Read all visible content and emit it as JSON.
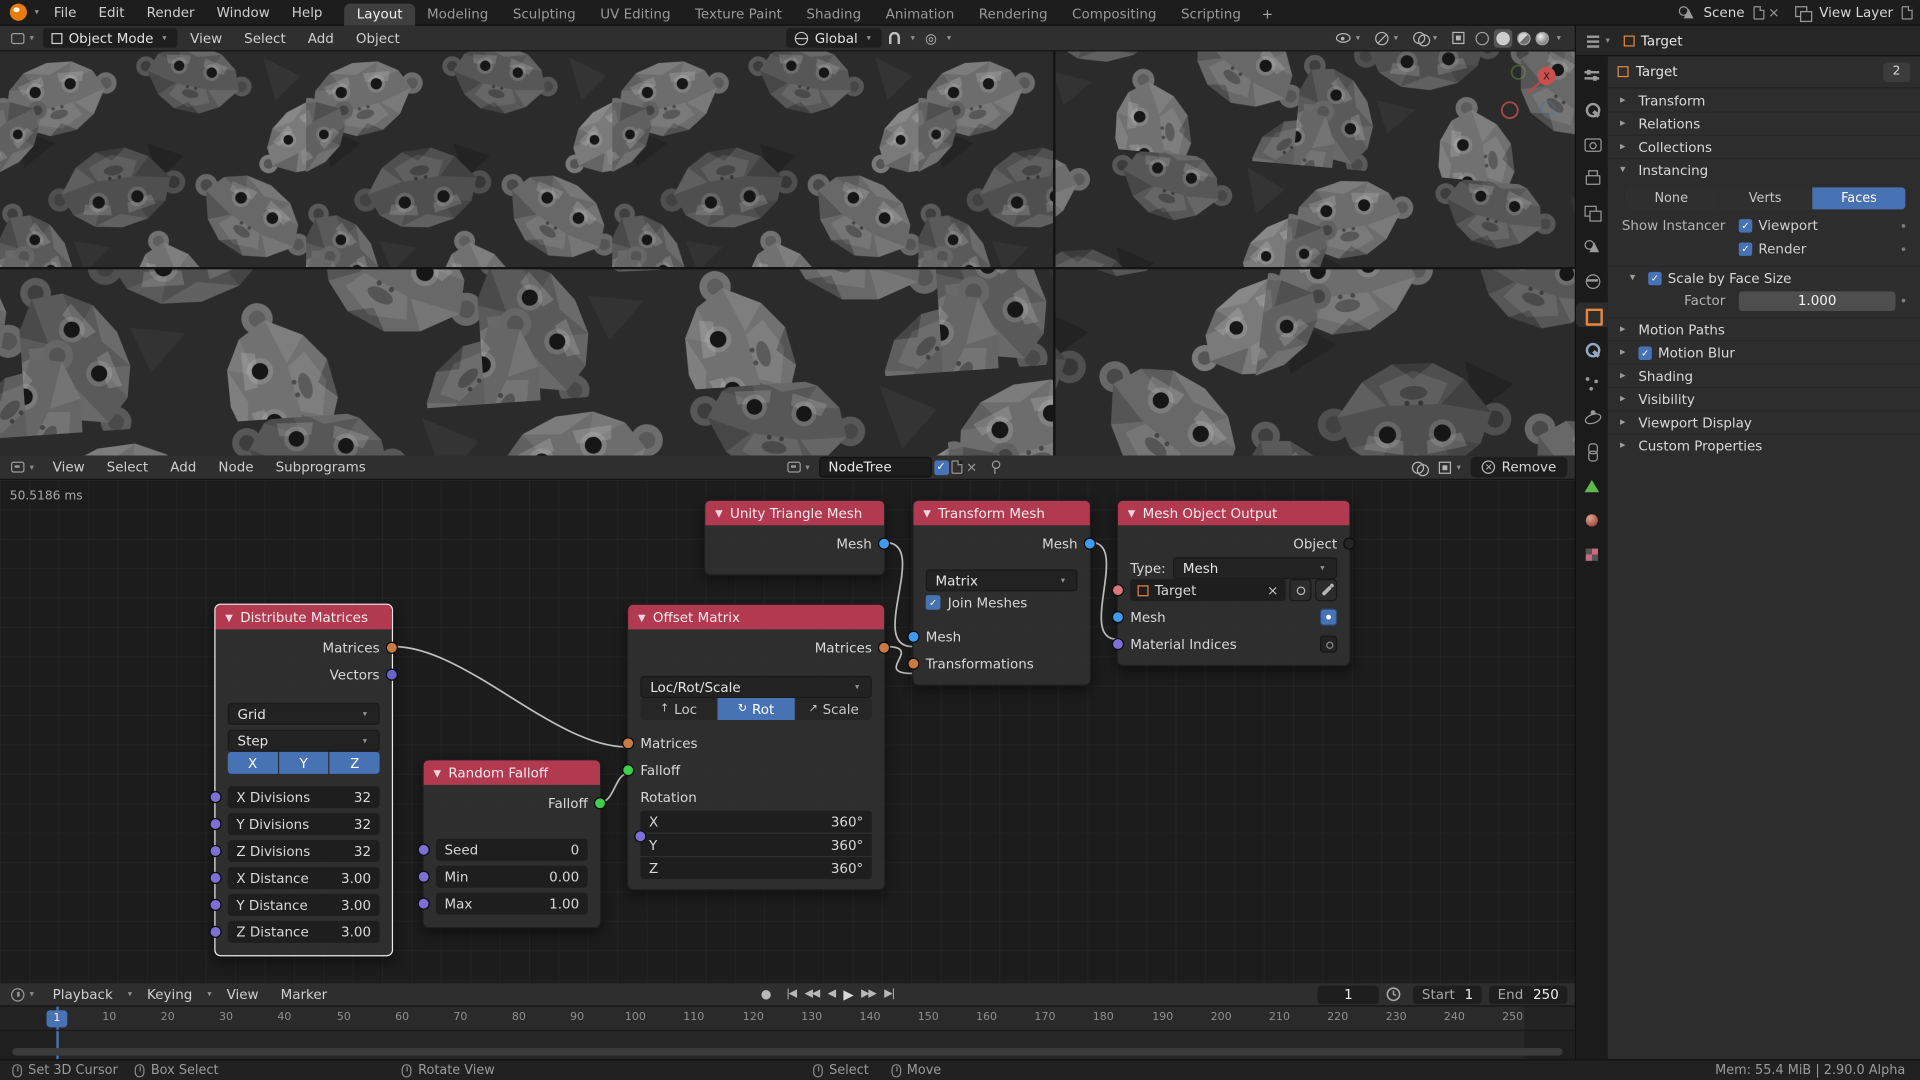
{
  "icons": {
    "record": "●",
    "jump_start": "|◀",
    "prev_key": "◀◀",
    "play_reverse": "◀",
    "play": "▶",
    "next_key": "▶▶",
    "jump_end": "▶|"
  },
  "colors": {
    "accent": "#4772b3",
    "node_header": "#b23a50",
    "blender_orange": "#e87d0d",
    "socket_matrix": "#c87a45",
    "socket_vector": "#6a63c9",
    "socket_number": "#7d6fd6",
    "socket_mesh": "#3f9bf0",
    "socket_falloff": "#3ecf4a",
    "socket_object": "#242424"
  },
  "topbar": {
    "menus": [
      "File",
      "Edit",
      "Render",
      "Window",
      "Help"
    ],
    "workspaces": [
      "Layout",
      "Modeling",
      "Sculpting",
      "UV Editing",
      "Texture Paint",
      "Shading",
      "Animation",
      "Rendering",
      "Compositing",
      "Scripting"
    ],
    "new_workspace": "+",
    "scene": "Scene",
    "view_layer": "View Layer"
  },
  "viewport_header": {
    "mode": "Object Mode",
    "menus": [
      "View",
      "Select",
      "Add",
      "Object"
    ],
    "orientation": "Global"
  },
  "viewport": {
    "gizmo_x": "X"
  },
  "node_editor": {
    "menus": [
      "View",
      "Select",
      "Add",
      "Node",
      "Subprograms"
    ],
    "tree_name": "NodeTree",
    "remove": "Remove",
    "stats": "50.5186 ms"
  },
  "nodes": {
    "distribute": {
      "title": "Distribute Matrices",
      "out1": "Matrices",
      "out2": "Vectors",
      "dd1": "Grid",
      "dd2": "Step",
      "ax": [
        "X",
        "Y",
        "Z"
      ],
      "rows": [
        {
          "l": "X Divisions",
          "v": "32"
        },
        {
          "l": "Y Divisions",
          "v": "32"
        },
        {
          "l": "Z Divisions",
          "v": "32"
        },
        {
          "l": "X Distance",
          "v": "3.00"
        },
        {
          "l": "Y Distance",
          "v": "3.00"
        },
        {
          "l": "Z Distance",
          "v": "3.00"
        }
      ]
    },
    "falloff": {
      "title": "Random Falloff",
      "out": "Falloff",
      "rows": [
        {
          "l": "Seed",
          "v": "0"
        },
        {
          "l": "Min",
          "v": "0.00"
        },
        {
          "l": "Max",
          "v": "1.00"
        }
      ]
    },
    "offset": {
      "title": "Offset Matrix",
      "out": "Matrices",
      "dd": "Loc/Rot/Scale",
      "modes": [
        "Loc",
        "Rot",
        "Scale"
      ],
      "in1": "Matrices",
      "in2": "Falloff",
      "in3": "Rotation",
      "rows": [
        {
          "l": "X",
          "v": "360°"
        },
        {
          "l": "Y",
          "v": "360°"
        },
        {
          "l": "Z",
          "v": "360°"
        }
      ]
    },
    "unity": {
      "title": "Unity Triangle Mesh",
      "out": "Mesh"
    },
    "transform": {
      "title": "Transform Mesh",
      "out": "Mesh",
      "dd": "Matrix",
      "check": "Join Meshes",
      "in1": "Mesh",
      "in2": "Transformations"
    },
    "output": {
      "title": "Mesh Object Output",
      "out": "Object",
      "type_label": "Type:",
      "type_value": "Mesh",
      "object_name": "Target",
      "in1": "Mesh",
      "in2": "Material Indices"
    }
  },
  "timeline": {
    "menus": [
      "Playback",
      "Keying",
      "View",
      "Marker"
    ],
    "frame": "1",
    "start_label": "Start",
    "start": "1",
    "end_label": "End",
    "end": "250",
    "playhead": "1",
    "ticks": [
      "1",
      "10",
      "20",
      "30",
      "40",
      "50",
      "60",
      "70",
      "80",
      "90",
      "100",
      "110",
      "120",
      "130",
      "140",
      "150",
      "160",
      "170",
      "180",
      "190",
      "200",
      "210",
      "220",
      "230",
      "240",
      "250"
    ]
  },
  "statusbar": {
    "items": [
      "Set 3D Cursor",
      "Box Select",
      "Rotate View",
      "Select",
      "Move"
    ],
    "info": "Mem: 55.4 MiB | 2.90.0 Alpha"
  },
  "outliner": {
    "item": "Target"
  },
  "properties": {
    "breadcrumb": "Target",
    "badge": "2",
    "panels": {
      "transform": "Transform",
      "relations": "Relations",
      "collections": "Collections",
      "instancing": "Instancing",
      "motion_paths": "Motion Paths",
      "motion_blur": "Motion Blur",
      "shading": "Shading",
      "visibility": "Visibility",
      "viewport_display": "Viewport Display",
      "custom_props": "Custom Properties"
    },
    "instancing": {
      "options": [
        "None",
        "Verts",
        "Faces"
      ],
      "show_instancer": "Show Instancer",
      "viewport": "Viewport",
      "render": "Render",
      "scale_by_face": "Scale by Face Size",
      "factor_label": "Factor",
      "factor": "1.000"
    }
  }
}
